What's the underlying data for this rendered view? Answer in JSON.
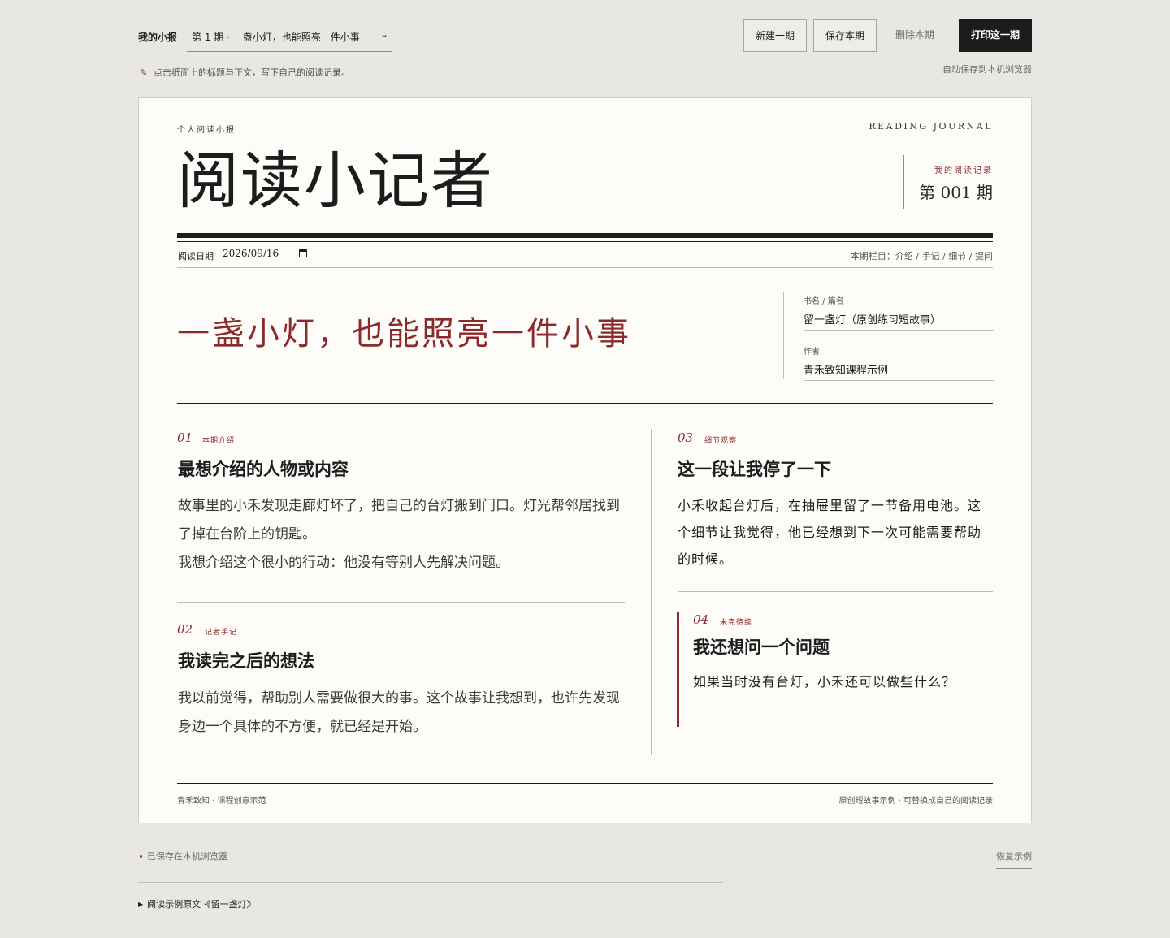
{
  "toolbar": {
    "brand": "我的小报",
    "issue_select_value": "第 1 期 · 一盏小灯，也能照亮一件小事",
    "new_label": "新建一期",
    "save_label": "保存本期",
    "delete_label": "删除本期",
    "print_label": "打印这一期",
    "hint": "点击纸面上的标题与正文，写下自己的阅读记录。",
    "autosave": "自动保存到本机浏览器"
  },
  "paper": {
    "kicker": "个人阅读小报",
    "journal_en": "READING JOURNAL",
    "masthead_title": "阅读小记者",
    "issue_label": "我的阅读记录",
    "issue_number": "第 001 期",
    "date_label": "阅读日期",
    "date_value": "2026/09/16",
    "columns": "本期栏目：介绍 / 手记 / 细节 / 提问",
    "headline": "一盏小灯，也能照亮一件小事",
    "book_label": "书名 / 篇名",
    "book_value": "留一盏灯（原创练习短故事）",
    "author_label": "作者",
    "author_value": "青禾致知课程示例",
    "sections": [
      {
        "num": "01",
        "tag": "本期介绍",
        "title": "最想介绍的人物或内容",
        "body1": "故事里的小禾发现走廊灯坏了，把自己的台灯搬到门口。灯光帮邻居找到了掉在台阶上的钥匙。",
        "body2": "我想介绍这个很小的行动：他没有等别人先解决问题。"
      },
      {
        "num": "02",
        "tag": "记者手记",
        "title": "我读完之后的想法",
        "body1": "我以前觉得，帮助别人需要做很大的事。这个故事让我想到，也许先发现身边一个具体的不方便，就已经是开始。"
      },
      {
        "num": "03",
        "tag": "细节观察",
        "title": "这一段让我停了一下",
        "body1": "小禾收起台灯后，在抽屉里留了一节备用电池。这个细节让我觉得，他已经想到下一次可能需要帮助的时候。"
      },
      {
        "num": "04",
        "tag": "未完待续",
        "title": "我还想问一个问题",
        "body1": "如果当时没有台灯，小禾还可以做些什么？"
      }
    ],
    "footer_left": "青禾致知 · 课程创意示范",
    "footer_right": "原创短故事示例 · 可替换成自己的阅读记录"
  },
  "bottom": {
    "saved_status": "已保存在本机浏览器",
    "restore_label": "恢复示例",
    "disclosure_label": "阅读示例原文 ·《留一盏灯》"
  },
  "colors": {
    "accent": "#8a2a2a",
    "ink": "#1c1c1c",
    "paper": "#fdfcf8",
    "background": "#e8e7e3"
  },
  "icons": [
    "pencil-icon",
    "chevron-down-icon",
    "calendar-icon",
    "disclosure-triangle-icon"
  ]
}
